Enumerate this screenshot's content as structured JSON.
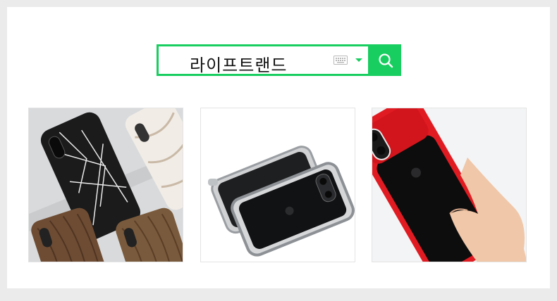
{
  "search": {
    "query": "라이프트랜드",
    "keyboard_icon": "keyboard-icon",
    "dropdown_icon": "caret-down-icon",
    "button_icon": "search-icon",
    "accent": "#19ce60"
  },
  "products": [
    {
      "icon": "phone-case-marble-wood-image"
    },
    {
      "icon": "phone-case-clear-bumper-image"
    },
    {
      "icon": "phone-case-red-hand-image"
    }
  ]
}
